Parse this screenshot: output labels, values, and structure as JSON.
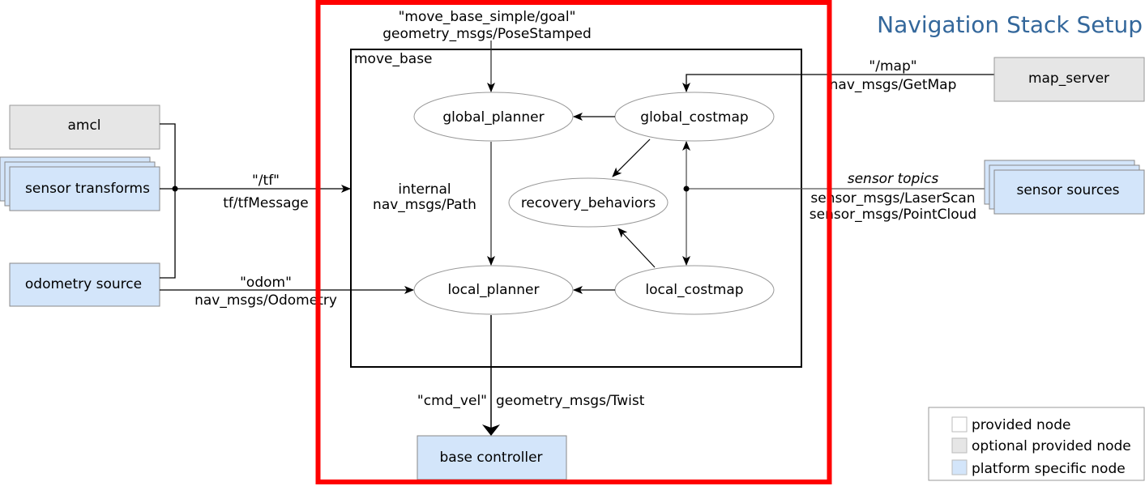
{
  "title": "Navigation Stack Setup",
  "colors": {
    "title": "#33679b",
    "highlight_frame": "#ff0000",
    "provided_node_fill": "#ffffff",
    "optional_node_fill": "#e6e6e6",
    "platform_node_fill": "#d3e5fa",
    "node_border": "#888888"
  },
  "container": {
    "label": "move_base"
  },
  "nodes": {
    "amcl": "amcl",
    "sensor_transforms": "sensor transforms",
    "odometry_source": "odometry source",
    "map_server": "map_server",
    "sensor_sources": "sensor sources",
    "base_controller": "base controller",
    "global_planner": "global_planner",
    "global_costmap": "global_costmap",
    "recovery_behaviors": "recovery_behaviors",
    "local_planner": "local_planner",
    "local_costmap": "local_costmap"
  },
  "edges": {
    "goal_topic": "\"move_base_simple/goal\"",
    "goal_type": "geometry_msgs/PoseStamped",
    "tf_topic": "\"/tf\"",
    "tf_type": "tf/tfMessage",
    "odom_topic": "\"odom\"",
    "odom_type": "nav_msgs/Odometry",
    "map_topic": "\"/map\"",
    "map_type": "nav_msgs/GetMap",
    "sensor_topics": "sensor topics",
    "sensor_type_1": "sensor_msgs/LaserScan",
    "sensor_type_2": "sensor_msgs/PointCloud",
    "path_label_1": "internal",
    "path_label_2": "nav_msgs/Path",
    "cmd_vel_topic": "\"cmd_vel\"",
    "cmd_vel_type": "geometry_msgs/Twist"
  },
  "legend": [
    {
      "label": "provided node",
      "kind": "provided"
    },
    {
      "label": "optional provided node",
      "kind": "optional"
    },
    {
      "label": "platform specific node",
      "kind": "platform"
    }
  ]
}
